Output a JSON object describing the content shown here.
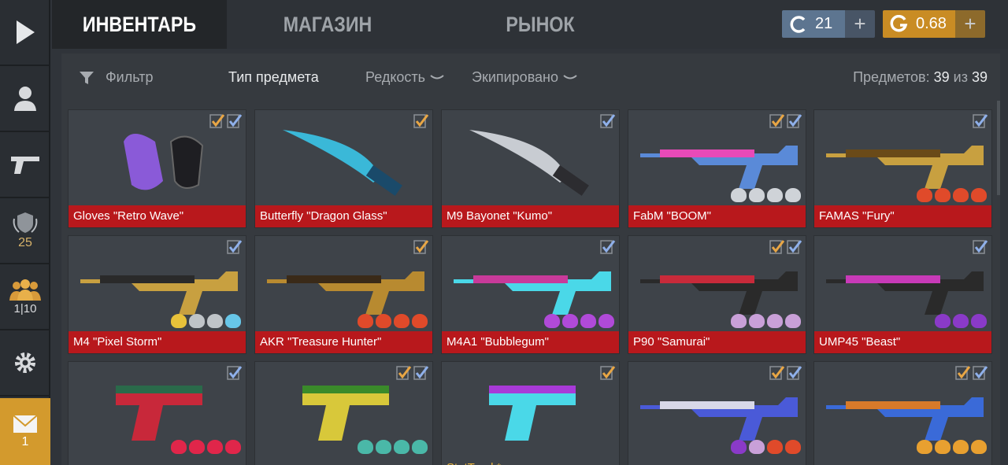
{
  "tabs": [
    {
      "label": "ИНВЕНТАРЬ",
      "active": true
    },
    {
      "label": "МАГАЗИН",
      "active": false
    },
    {
      "label": "РЫНОК",
      "active": false
    }
  ],
  "currency": {
    "credits": {
      "value": "21",
      "icon": "credit-c-icon",
      "color": "#5d7590"
    },
    "gold": {
      "value": "0.68",
      "icon": "gold-g-icon",
      "color": "#c98c24"
    },
    "plus": "+"
  },
  "sidebar": {
    "level": "25",
    "party": "1|10",
    "mail_count": "1"
  },
  "filter": {
    "filter_label": "Фильтр",
    "type_label": "Тип предмета",
    "rarity_label": "Редкость",
    "equipped_label": "Экипировано",
    "count_prefix": "Предметов:",
    "count_current": "39",
    "count_sep": "из",
    "count_total": "39"
  },
  "items": [
    {
      "name": "Gloves \"Retro Wave\"",
      "checks": [
        "gold",
        "blue"
      ],
      "rarity": "red",
      "stickers": []
    },
    {
      "name": "Butterfly \"Dragon Glass\"",
      "checks": [
        "gold"
      ],
      "rarity": "red",
      "stickers": []
    },
    {
      "name": "M9 Bayonet \"Kumo\"",
      "checks": [
        "blue"
      ],
      "rarity": "red",
      "stickers": []
    },
    {
      "name": "FabM \"BOOM\"",
      "checks": [
        "gold",
        "blue"
      ],
      "rarity": "red",
      "stickers": [
        "#cfd3d8",
        "#cfd3d8",
        "#cfd3d8",
        "#cfd3d8"
      ]
    },
    {
      "name": "FAMAS \"Fury\"",
      "checks": [
        "blue"
      ],
      "rarity": "red",
      "stickers": [
        "#e04a2a",
        "#e04a2a",
        "#e04a2a",
        "#e04a2a"
      ]
    },
    {
      "name": "M4 \"Pixel Storm\"",
      "checks": [
        "blue"
      ],
      "rarity": "red",
      "stickers": [
        "#e8c23a",
        "#bfc4c8",
        "#bfc4c8",
        "#67c6e8"
      ]
    },
    {
      "name": "AKR \"Treasure Hunter\"",
      "checks": [
        "gold"
      ],
      "rarity": "red",
      "stickers": [
        "#e04a2a",
        "#e04a2a",
        "#e04a2a",
        "#e04a2a"
      ]
    },
    {
      "name": "M4A1 \"Bubblegum\"",
      "checks": [
        "blue"
      ],
      "rarity": "red",
      "stickers": [
        "#b04ad8",
        "#b04ad8",
        "#b04ad8",
        "#b04ad8"
      ]
    },
    {
      "name": "P90 \"Samurai\"",
      "checks": [
        "gold",
        "blue"
      ],
      "rarity": "red",
      "stickers": [
        "#c9a0d8",
        "#c9a0d8",
        "#c9a0d8",
        "#c9a0d8"
      ]
    },
    {
      "name": "UMP45 \"Beast\"",
      "checks": [
        "blue"
      ],
      "rarity": "red",
      "stickers": [
        "#8a3ac8",
        "#8a3ac8",
        "#8a3ac8"
      ]
    },
    {
      "name": "",
      "checks": [
        "blue"
      ],
      "rarity": "red",
      "stickers": [
        "#e0264a",
        "#e0264a",
        "#e0264a",
        "#e0264a"
      ]
    },
    {
      "name": "",
      "checks": [
        "gold",
        "blue"
      ],
      "rarity": "red",
      "stickers": [
        "#4ab8a8",
        "#4ab8a8",
        "#4ab8a8",
        "#4ab8a8"
      ]
    },
    {
      "name": "",
      "checks": [
        "gold"
      ],
      "rarity": "purple",
      "stattrack": "StatTrack*",
      "stickers": []
    },
    {
      "name": "",
      "checks": [
        "gold",
        "blue"
      ],
      "rarity": "red",
      "stickers": [
        "#8a3ac8",
        "#c9a0d8",
        "#e04a2a",
        "#e04a2a"
      ]
    },
    {
      "name": "",
      "checks": [
        "gold",
        "blue"
      ],
      "rarity": "red",
      "stickers": [
        "#e8a030",
        "#e8a030",
        "#e8a030",
        "#e8a030"
      ]
    }
  ],
  "colors": {
    "gold_check": "#e8a645",
    "blue_check": "#8fb0ea",
    "rarity_red": "#b8181c",
    "rarity_purple": "#8a1f9a"
  }
}
